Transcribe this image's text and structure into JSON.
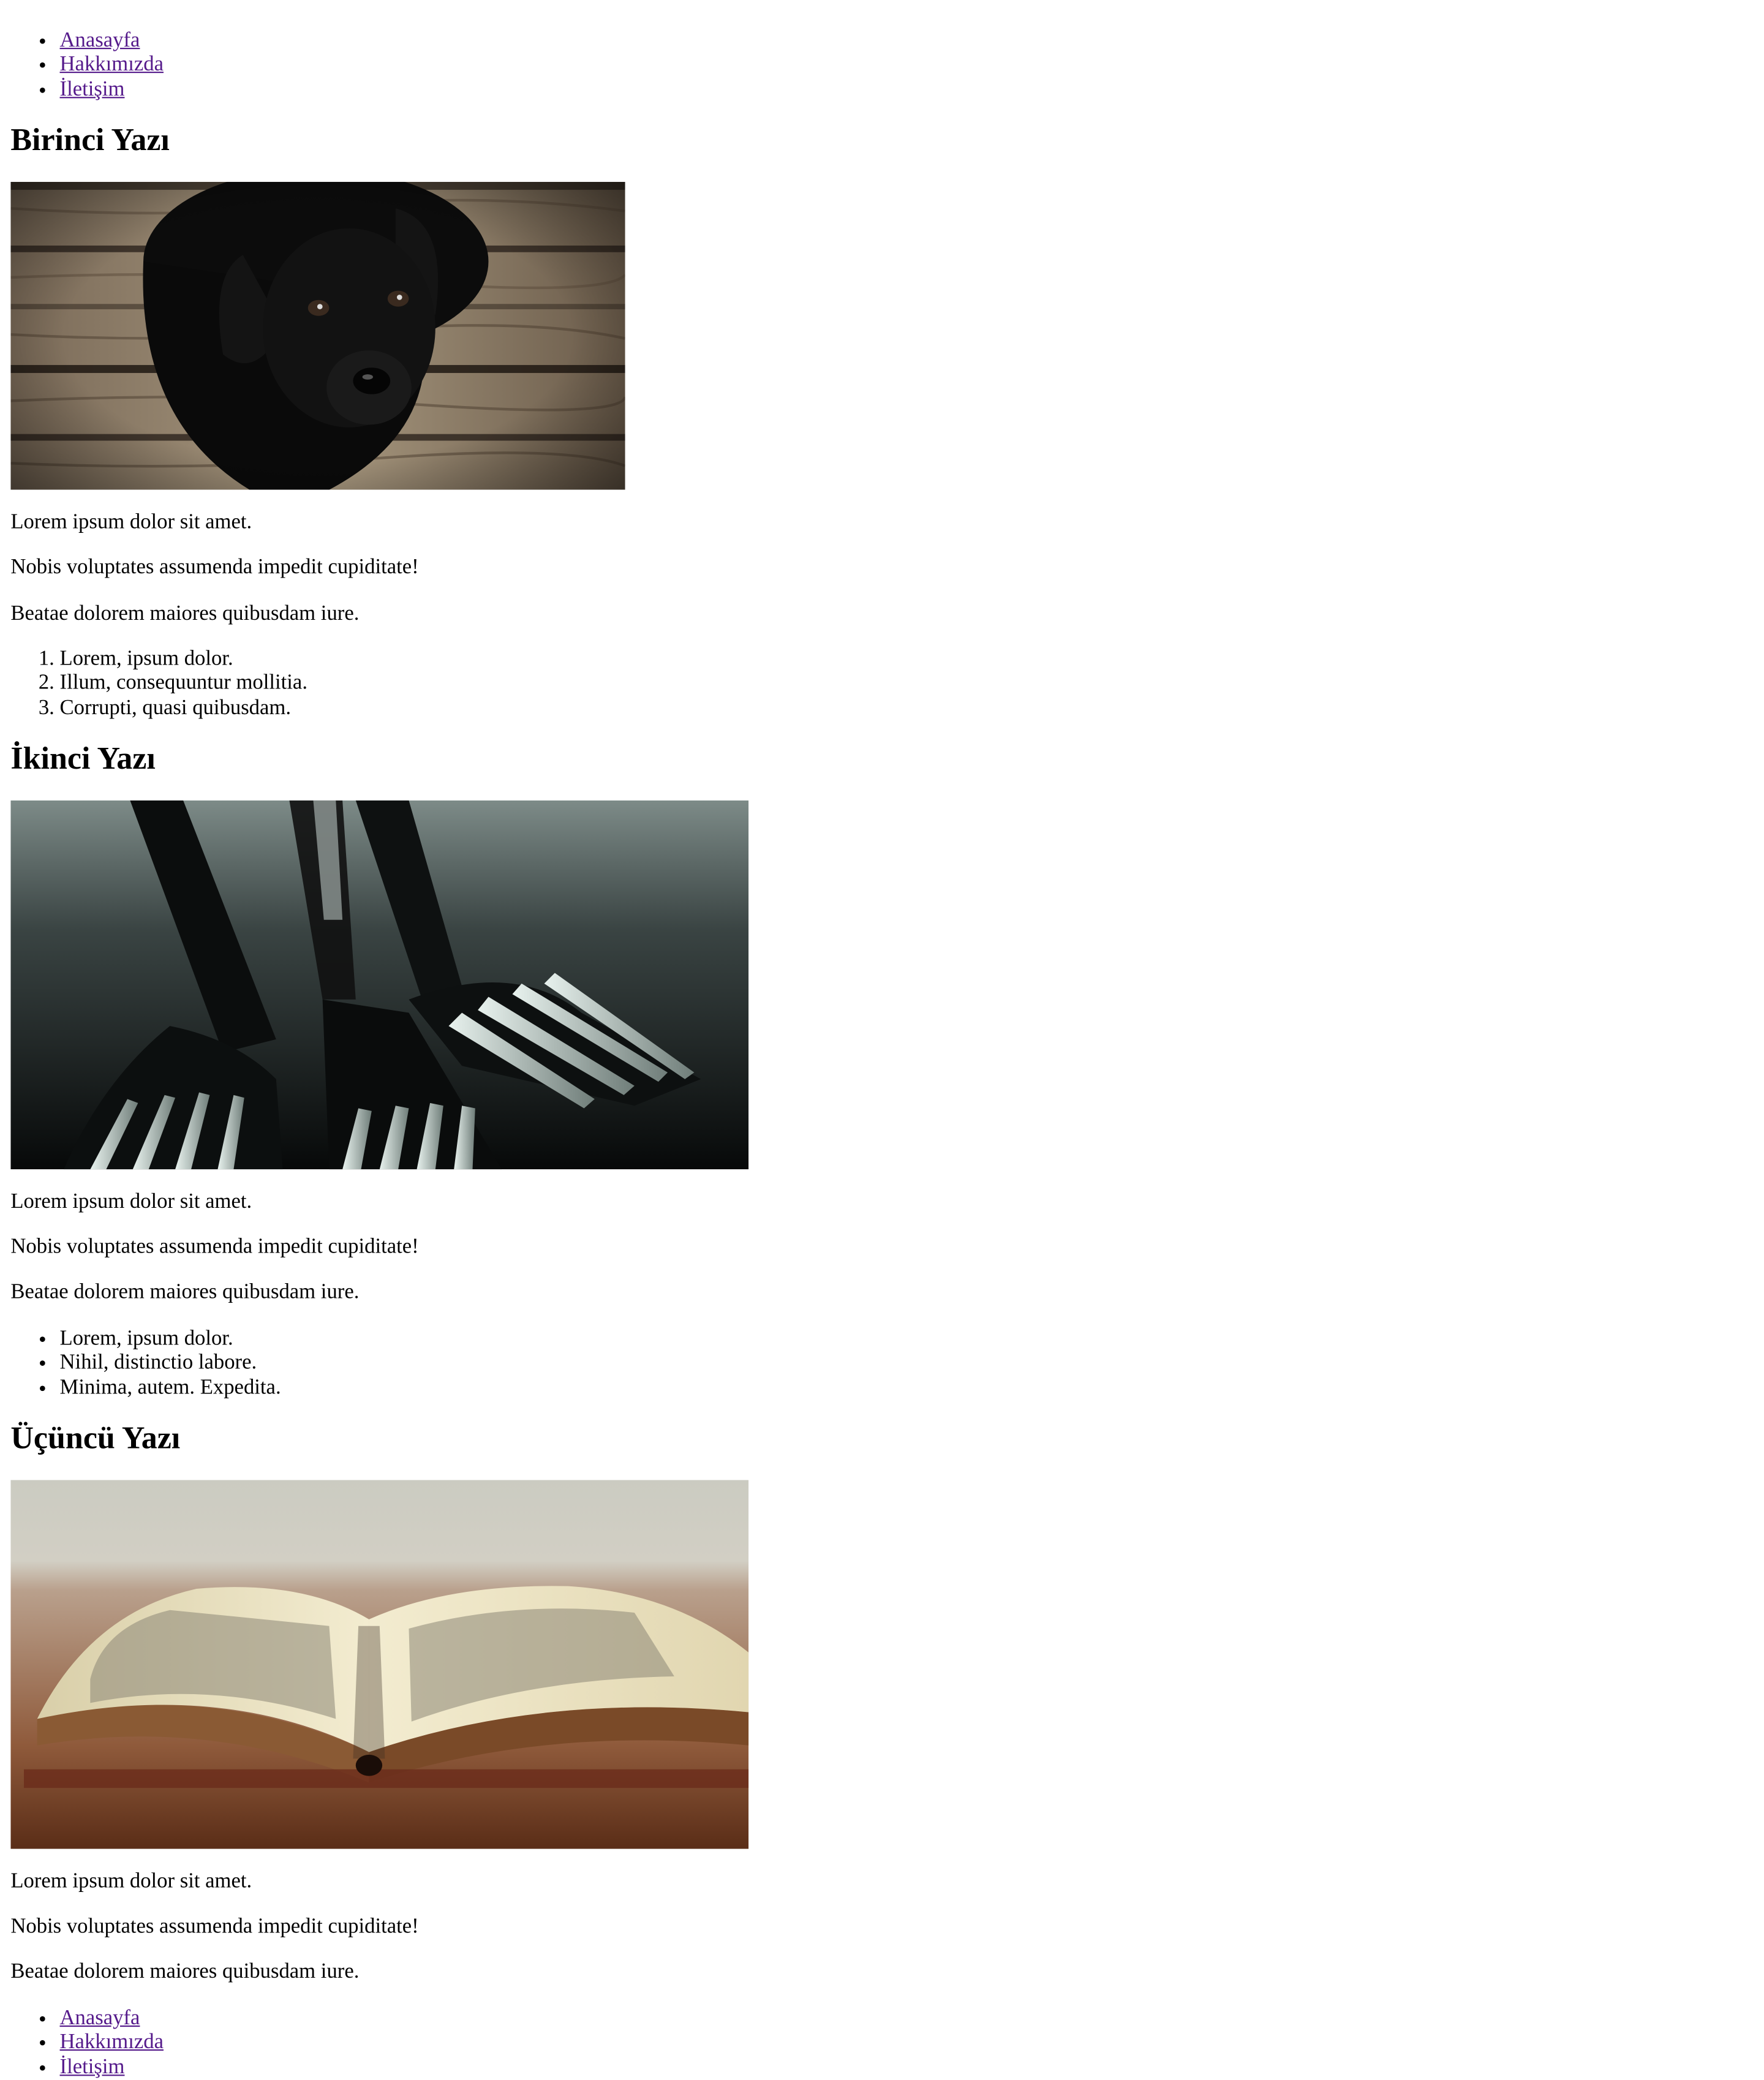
{
  "nav_top": {
    "items": [
      {
        "label": "Anasayfa"
      },
      {
        "label": "Hakkımızda"
      },
      {
        "label": "İletişim"
      }
    ]
  },
  "posts": [
    {
      "title": "Birinci Yazı",
      "image_alt": "black-puppy-photo",
      "paragraphs": [
        "Lorem ipsum dolor sit amet.",
        "Nobis voluptates assumenda impedit cupiditate!",
        "Beatae dolorem maiores quibusdam iure."
      ],
      "list_type": "ordered",
      "list": [
        "Lorem, ipsum dolor.",
        "Illum, consequuntur mollitia.",
        "Corrupti, quasi quibusdam."
      ]
    },
    {
      "title": "İkinci Yazı",
      "image_alt": "forks-photo",
      "paragraphs": [
        "Lorem ipsum dolor sit amet.",
        "Nobis voluptates assumenda impedit cupiditate!",
        "Beatae dolorem maiores quibusdam iure."
      ],
      "list_type": "unordered",
      "list": [
        "Lorem, ipsum dolor.",
        "Nihil, distinctio labore.",
        "Minima, autem. Expedita."
      ]
    },
    {
      "title": "Üçüncü Yazı",
      "image_alt": "open-book-photo",
      "paragraphs": [
        "Lorem ipsum dolor sit amet.",
        "Nobis voluptates assumenda impedit cupiditate!",
        "Beatae dolorem maiores quibusdam iure."
      ]
    }
  ],
  "nav_bottom": {
    "items": [
      {
        "label": "Anasayfa"
      },
      {
        "label": "Hakkımızda"
      },
      {
        "label": "İletişim"
      }
    ]
  },
  "colors": {
    "link_visited": "#551a8b",
    "text": "#000000",
    "background": "#ffffff"
  }
}
